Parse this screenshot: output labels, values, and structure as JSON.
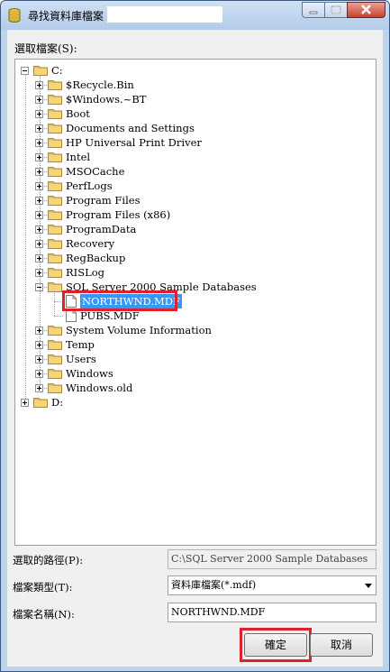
{
  "window": {
    "title": "尋找資料庫檔案 -"
  },
  "select_file_label": "選取檔案(S):",
  "tree": {
    "roots": [
      {
        "label": "C:",
        "expanded": true
      },
      {
        "label": "D:",
        "expanded": false
      }
    ],
    "c_children": [
      "$Recycle.Bin",
      "$Windows.~BT",
      "Boot",
      "Documents and Settings",
      "HP Universal Print Driver",
      "Intel",
      "MSOCache",
      "PerfLogs",
      "Program Files",
      "Program Files (x86)",
      "ProgramData",
      "Recovery",
      "RegBackup",
      "RISLog",
      "SQL Server 2000 Sample Databases",
      "System Volume Information",
      "Temp",
      "Users",
      "Windows",
      "Windows.old"
    ],
    "sql_files": [
      "NORTHWND.MDF",
      "PUBS.MDF"
    ],
    "selected_file": "NORTHWND.MDF"
  },
  "fields": {
    "path_label": "選取的路徑(P):",
    "path_value": "C:\\SQL Server 2000 Sample Databases",
    "type_label": "檔案類型(T):",
    "type_value": "資料庫檔案(*.mdf)",
    "name_label": "檔案名稱(N):",
    "name_value": "NORTHWND.MDF"
  },
  "buttons": {
    "ok": "確定",
    "cancel": "取消"
  },
  "colors": {
    "selection": "#3399ff",
    "highlight_box": "#e0202a",
    "folder": "#e8c15a"
  },
  "icons": {
    "app": "database-icon",
    "folder": "folder-icon",
    "file": "file-icon"
  }
}
